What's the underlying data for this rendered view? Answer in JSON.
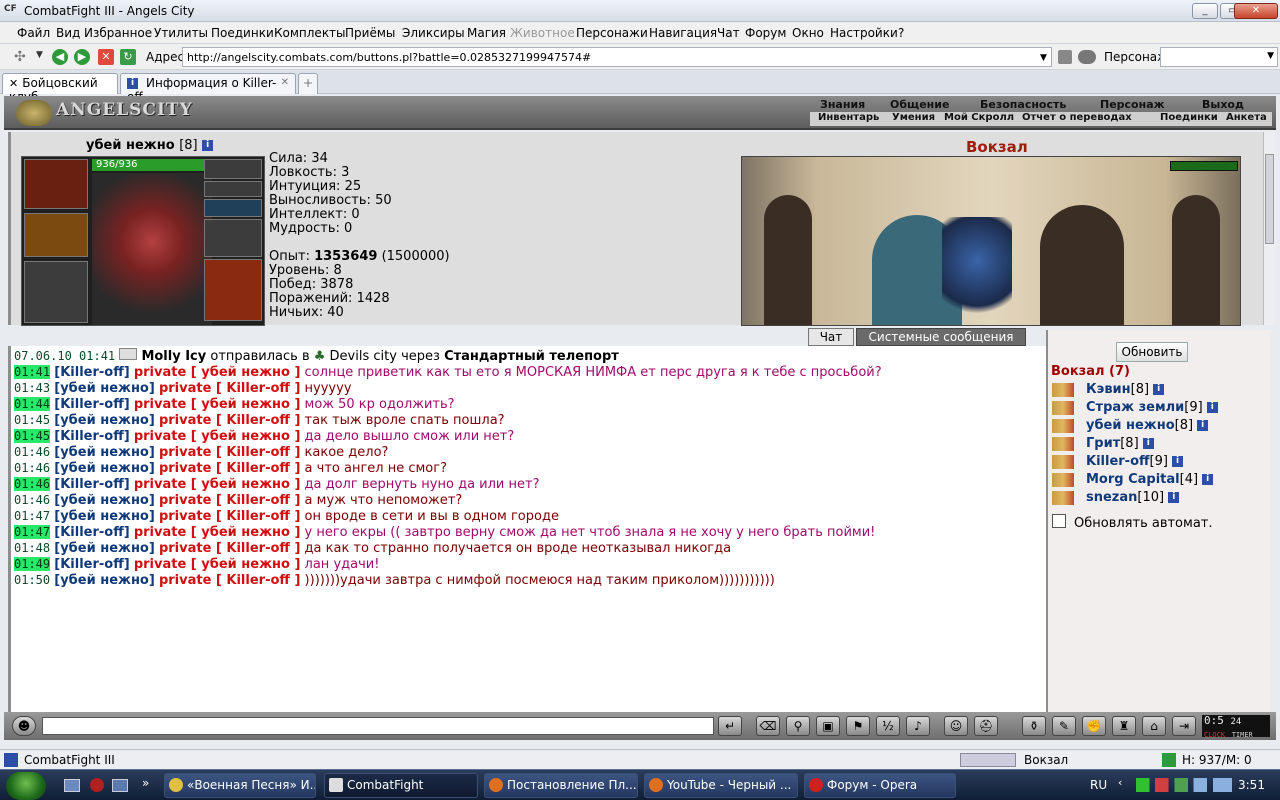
{
  "window": {
    "title": "CombatFight III - Angels City",
    "logo": "CF"
  },
  "menu": [
    "Файл",
    "Вид",
    "Избранное",
    "Утилиты",
    "Поединки",
    "Комплекты",
    "Приёмы",
    "Эликсиры",
    "Магия",
    "Животное",
    "Персонажи",
    "Навигация",
    "Чат",
    "Форум",
    "Окно",
    "Настройки",
    "?"
  ],
  "address": {
    "label": "Адрес:",
    "url": "http://angelscity.combats.com/buttons.pl?battle=0.0285327199947574#",
    "person_label": "Персонаж:"
  },
  "tabs": [
    {
      "label": "Бойцовский клуб"
    },
    {
      "label": "Информация о Killer-off"
    }
  ],
  "game": {
    "logo": "ANGELSCITY",
    "top_links": [
      "Знания",
      "Общение",
      "Безопасность",
      "Персонаж",
      "Выход"
    ],
    "sub_links": [
      "Инвентарь",
      "Умения",
      "Мой Скролл",
      "Отчет о переводах",
      "Поединки",
      "Анкета"
    ]
  },
  "character": {
    "name": "убей нежно",
    "level": "[8]",
    "hp": "936/936",
    "stats": [
      {
        "label": "Сила:",
        "value": "34"
      },
      {
        "label": "Ловкость:",
        "value": "3"
      },
      {
        "label": "Интуиция:",
        "value": "25"
      },
      {
        "label": "Выносливость:",
        "value": "50"
      },
      {
        "label": "Интеллект:",
        "value": "0"
      },
      {
        "label": "Мудрость:",
        "value": "0"
      }
    ],
    "exp_label": "Опыт:",
    "exp_value": "1353649",
    "exp_next": "(1500000)",
    "extra": [
      {
        "label": "Уровень:",
        "value": "8"
      },
      {
        "label": "Побед:",
        "value": "3878"
      },
      {
        "label": "Поражений:",
        "value": "1428"
      },
      {
        "label": "Ничьих:",
        "value": "40"
      }
    ]
  },
  "location": {
    "name": "Вокзал"
  },
  "chat_tabs": {
    "chat": "Чат",
    "system": "Системные сообщения"
  },
  "system_msg": {
    "date": "07.06.10 01:41",
    "who": "Molly Icy",
    "action": "отправилась в",
    "dest": "Devils city",
    "via": "через",
    "method": "Стандартный телепорт"
  },
  "messages": [
    {
      "time": "01:41",
      "hl": true,
      "from": "[Killer-off]",
      "to": "private [ убей нежно ]",
      "text": "солнце приветик как ты ето я МОРСКАЯ НИМФА ет перс друга я к тебе с просьбой?",
      "c": "r"
    },
    {
      "time": "01:43",
      "hl": false,
      "from": "[убей нежно]",
      "to": "private [ Killer-off ]",
      "text": "нууууу",
      "c": "d"
    },
    {
      "time": "01:44",
      "hl": true,
      "from": "[Killer-off]",
      "to": "private [ убей нежно ]",
      "text": "мож 50 кр одолжить?",
      "c": "r"
    },
    {
      "time": "01:45",
      "hl": false,
      "from": "[убей нежно]",
      "to": "private [ Killer-off ]",
      "text": "так тыж вроле спать пошла?",
      "c": "d"
    },
    {
      "time": "01:45",
      "hl": true,
      "from": "[Killer-off]",
      "to": "private [ убей нежно ]",
      "text": "да дело вышло смож или нет?",
      "c": "r"
    },
    {
      "time": "01:46",
      "hl": false,
      "from": "[убей нежно]",
      "to": "private [ Killer-off ]",
      "text": "какое дело?",
      "c": "d"
    },
    {
      "time": "01:46",
      "hl": false,
      "from": "[убей нежно]",
      "to": "private [ Killer-off ]",
      "text": "а что ангел не смог?",
      "c": "d"
    },
    {
      "time": "01:46",
      "hl": true,
      "from": "[Killer-off]",
      "to": "private [ убей нежно ]",
      "text": "да долг вернуть нуно да или нет?",
      "c": "r"
    },
    {
      "time": "01:46",
      "hl": false,
      "from": "[убей нежно]",
      "to": "private [ Killer-off ]",
      "text": "а муж что непоможет?",
      "c": "d"
    },
    {
      "time": "01:47",
      "hl": false,
      "from": "[убей нежно]",
      "to": "private [ Killer-off ]",
      "text": "он вроде в сети и вы в одном городе",
      "c": "d"
    },
    {
      "time": "01:47",
      "hl": true,
      "from": "[Killer-off]",
      "to": "private [ убей нежно ]",
      "text": "у него екры (( завтро верну смож да нет чтоб знала я не хочу у него брать пойми!",
      "c": "r"
    },
    {
      "time": "01:48",
      "hl": false,
      "from": "[убей нежно]",
      "to": "private [ Killer-off ]",
      "text": "да как то странно получается он вроде неотказывал никогда",
      "c": "d"
    },
    {
      "time": "01:49",
      "hl": true,
      "from": "[Killer-off]",
      "to": "private [ убей нежно ]",
      "text": "лан удачи!",
      "c": "r"
    },
    {
      "time": "01:50",
      "hl": false,
      "from": "[убей нежно]",
      "to": "private [ Killer-off ]",
      "text": ")))))))удачи завтра с нимфой посмеюся над таким приколом)))))))))))",
      "c": "d"
    }
  ],
  "room": {
    "refresh": "Обновить",
    "title": "Вокзал (7)",
    "auto": "Обновлять автомат.",
    "players": [
      {
        "name": "Кэвин",
        "lvl": "[8]"
      },
      {
        "name": "Страж земли",
        "lvl": "[9]"
      },
      {
        "name": "убей нежно",
        "lvl": "[8]"
      },
      {
        "name": "Грит",
        "lvl": "[8]"
      },
      {
        "name": "Killer-off",
        "lvl": "[9]"
      },
      {
        "name": "Morg Capital",
        "lvl": "[4]"
      },
      {
        "name": "snezan",
        "lvl": "[10]"
      }
    ]
  },
  "clock": {
    "time": "0:5",
    "sec": "24",
    "label1": "CLOCK",
    "label2": "TIMER"
  },
  "status": {
    "left": "CombatFight III",
    "zone": "Вокзал",
    "hm": "H: 937/M: 0"
  },
  "taskbar": {
    "items": [
      "«Военная Песня» И...",
      "CombatFight",
      "Постановление Пл...",
      "YouTube - Черный ...",
      "Форум - Opera"
    ],
    "lang": "RU",
    "time": "3:51"
  }
}
